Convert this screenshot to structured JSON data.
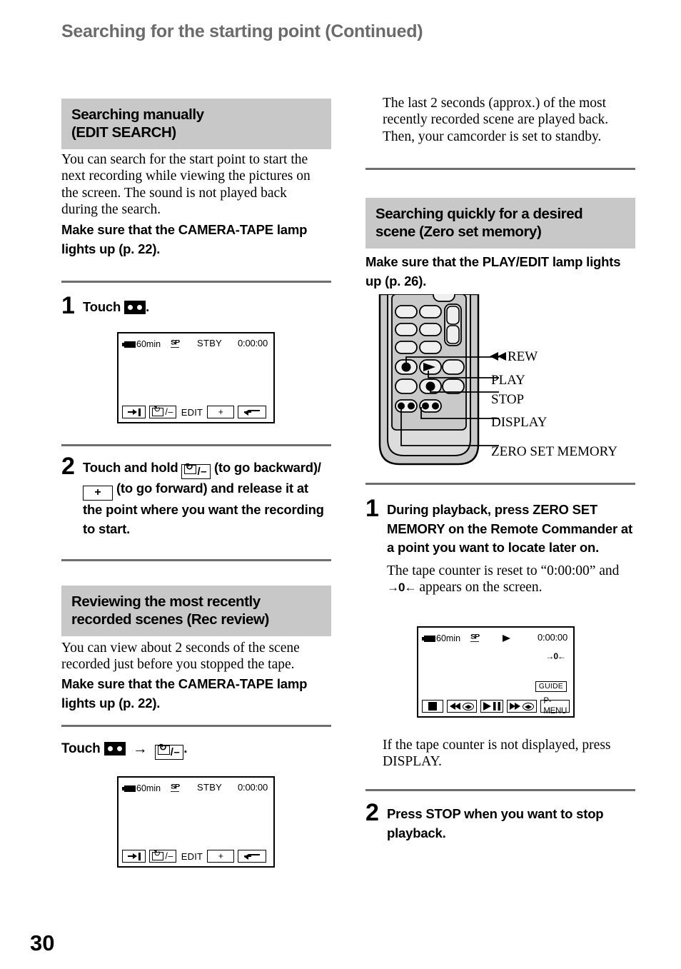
{
  "page": {
    "header": "Searching for the starting point (Continued)",
    "number": "30"
  },
  "left_column": {
    "section1": {
      "heading_line1": "Searching manually",
      "heading_line2": "(EDIT SEARCH)",
      "intro": "You can search for the start point to start the next recording while viewing the pictures on the screen. The sound is not played back during the search.",
      "note": "Make sure that the CAMERA-TAPE lamp lights up (p. 22).",
      "step1": {
        "number": "1",
        "text_before_icon": "Touch",
        "icon": "tape-button-icon",
        "text_after_icon": "."
      },
      "step2": {
        "number": "2",
        "line1_a": "Touch and hold",
        "icon1": "rec-review-minus-button-icon",
        "line1_b": "(to go",
        "line2_a": "backward)/",
        "icon2_label": "+",
        "line2_b": "(to go forward)",
        "line3": "and release it at the point where",
        "line4": "you want the recording to start."
      }
    },
    "section2": {
      "heading_line1": "Reviewing the most recently",
      "heading_line2": "recorded scenes (Rec review)",
      "intro": "You can view about 2 seconds of the scene recorded just before you stopped the tape.",
      "note": "Make sure that the CAMERA-TAPE lamp lights up (p. 22).",
      "touch_line": {
        "label": "Touch",
        "icon1": "tape-button-icon",
        "arrow": "→",
        "icon2": "rec-review-minus-button-icon",
        "period": "."
      }
    },
    "lcd_screen_1": {
      "battery": "60min",
      "tape_mode": "SP",
      "status": "STBY",
      "counter": "0:00:00",
      "buttons": [
        "end-search-icon",
        "rec-review-minus-icon",
        "EDIT",
        "+",
        "return-icon"
      ],
      "edit_label": "EDIT",
      "plus_label": "+"
    },
    "lcd_screen_2": {
      "battery": "60min",
      "tape_mode": "SP",
      "status": "STBY",
      "counter": "0:00:00",
      "edit_label": "EDIT",
      "plus_label": "+"
    }
  },
  "right_column": {
    "intro_text": "The last 2 seconds (approx.) of the most recently recorded scene are played back. Then, your camcorder is set to standby.",
    "section3": {
      "heading_line1": "Searching quickly for a desired",
      "heading_line2": "scene (Zero set memory)",
      "note": "Make sure that the PLAY/EDIT lamp lights up (p. 26).",
      "callouts": [
        {
          "label": "REW",
          "has_rew_glyph": true
        },
        {
          "label": "PLAY",
          "has_rew_glyph": false
        },
        {
          "label": "STOP",
          "has_rew_glyph": false
        },
        {
          "label": "DISPLAY",
          "has_rew_glyph": false
        },
        {
          "label": "ZERO SET MEMORY",
          "has_rew_glyph": false
        }
      ],
      "step1": {
        "number": "1",
        "line1": "During playback, press ZERO",
        "line2": "SET MEMORY on the Remote",
        "line3": "Commander at a point you want",
        "line4": "to locate later on.",
        "sub_a": "The tape counter is reset to “0:00:00”",
        "sub_b": "and",
        "sub_glyph": "zero-set-memory-indicator-icon",
        "sub_c": "appears on the screen."
      },
      "after_lcd_text": "If the tape counter is not displayed, press DISPLAY.",
      "step2": {
        "number": "2",
        "line1": "Press STOP when you want to",
        "line2": "stop playback."
      }
    },
    "lcd_screen_3": {
      "battery": "60min",
      "tape_mode": "SP",
      "play_indicator": "play-triangle-icon",
      "counter": "0:00:00",
      "zero_set_memory_indicator": "→0←",
      "guide_label": "GUIDE",
      "pmenu_label": "P-MENU"
    }
  },
  "colors": {
    "heading_gray": "#c8c8c8",
    "title_gray": "#6b6b6b",
    "rule_gray": "#6e6e6e"
  }
}
